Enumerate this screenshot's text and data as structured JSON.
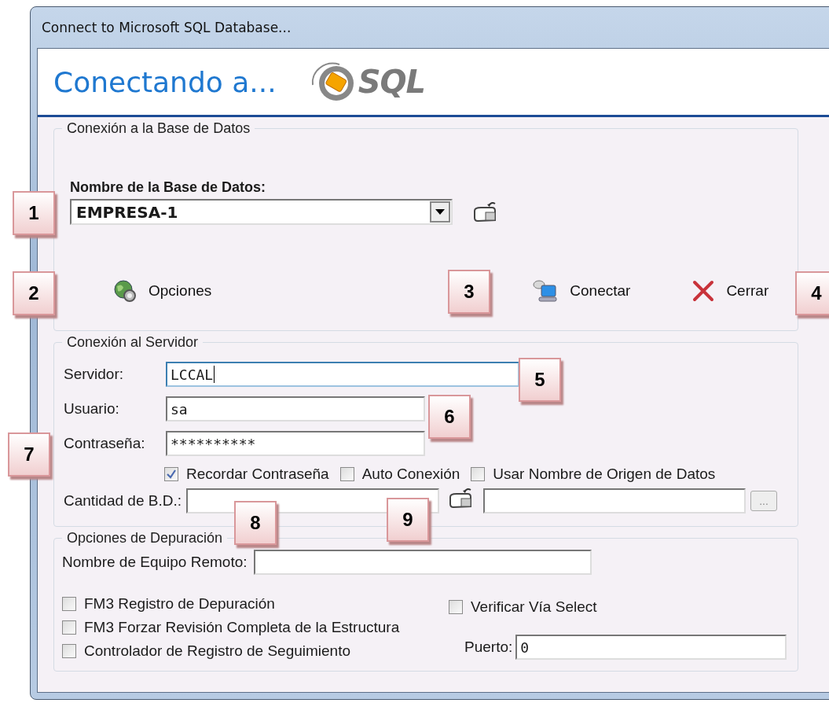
{
  "window": {
    "title": "Connect to Microsoft SQL Database..."
  },
  "header": {
    "title": "Conectando a...",
    "logo_text": "SQL"
  },
  "database_group": {
    "legend": "Conexión a la Base de Datos",
    "label": "Nombre de la Base de Datos:",
    "combo": {
      "value": "EMPRESA-1"
    },
    "buttons": [
      {
        "label": "Opciones",
        "kind": "options"
      },
      {
        "label": "Conectar",
        "kind": "connect"
      },
      {
        "label": "Cerrar",
        "kind": "close"
      }
    ]
  },
  "server_group": {
    "legend": "Conexión al Servidor",
    "fields": [
      {
        "label": "Servidor:",
        "value": "LCCAL",
        "focused": true
      },
      {
        "label": "Usuario:",
        "value": "sa",
        "focused": false
      },
      {
        "label": "Contraseña:",
        "value": "**********",
        "focused": false
      }
    ],
    "checkboxes": [
      {
        "label": "Recordar Contraseña",
        "checked": true
      },
      {
        "label": "Auto Conexión",
        "checked": false
      },
      {
        "label": "Usar Nombre de Origen de Datos",
        "checked": false
      }
    ],
    "db_count": {
      "label": "Cantidad de B.D.:"
    },
    "browse_button": "..."
  },
  "debug_group": {
    "legend": "Opciones de Depuración",
    "remote": {
      "label": "Nombre de Equipo Remoto:"
    },
    "checkboxes": [
      {
        "label": "FM3 Registro de Depuración",
        "checked": false
      },
      {
        "label": "FM3 Forzar Revisión Completa de la Estructura",
        "checked": false
      },
      {
        "label": "Controlador de Registro de Seguimiento",
        "checked": false
      },
      {
        "label": "Verificar Vía Select",
        "checked": false
      }
    ],
    "port": {
      "label": "Puerto:",
      "value": "0"
    }
  },
  "callouts": [
    "1",
    "2",
    "3",
    "4",
    "5",
    "6",
    "7",
    "8",
    "9"
  ]
}
